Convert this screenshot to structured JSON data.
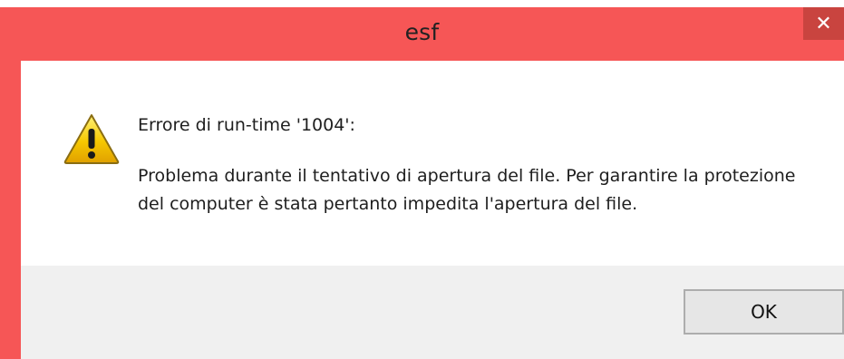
{
  "dialog": {
    "title": "esf",
    "close_glyph": "✕",
    "icon": "warning-icon",
    "heading": "Errore di run-time '1004':",
    "message": "Problema durante il tentativo di apertura del file. Per garantire la protezione del computer è stata pertanto impedita l'apertura del file.",
    "ok_label": "OK"
  },
  "colors": {
    "titlebar": "#f65656",
    "close_button": "#c9443f",
    "footer": "#f0f0f0",
    "warning_yellow": "#f6c800"
  }
}
